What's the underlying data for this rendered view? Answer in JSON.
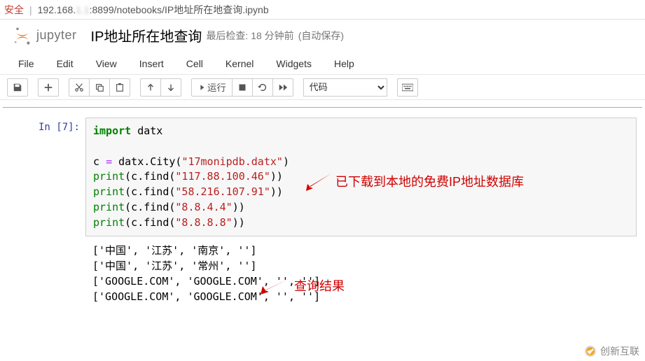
{
  "address_bar": {
    "security": "安全",
    "url_prefix": "192.168.",
    "url_blur": "1.1",
    "url_suffix": ":8899/notebooks/IP地址所在地查询.ipynb"
  },
  "header": {
    "logo_text": "jupyter",
    "notebook_title": "IP地址所在地查询",
    "last_check": "最后检查: 18 分钟前",
    "autosave": "(自动保存)"
  },
  "menu": {
    "items": [
      "File",
      "Edit",
      "View",
      "Insert",
      "Cell",
      "Kernel",
      "Widgets",
      "Help"
    ]
  },
  "toolbar": {
    "run_label": "运行",
    "cell_type": "代码"
  },
  "cell": {
    "prompt": "In  [7]:",
    "code": {
      "import_kw": "import",
      "import_mod": " datx",
      "assign_lhs": "c ",
      "assign_op": "=",
      "assign_rhs_a": " datx.City(",
      "db_file": "\"17monipdb.datx\"",
      "assign_rhs_b": ")",
      "p1a": "print",
      "p1b": "(c.find(",
      "p1s": "\"117.88.100.46\"",
      "p1c": "))",
      "p2a": "print",
      "p2b": "(c.find(",
      "p2s": "\"58.216.107.91\"",
      "p2c": "))",
      "p3a": "print",
      "p3b": "(c.find(",
      "p3s": "\"8.8.4.4\"",
      "p3c": "))",
      "p4a": "print",
      "p4b": "(c.find(",
      "p4s": "\"8.8.8.8\"",
      "p4c": "))"
    },
    "output": "['中国', '江苏', '南京', '']\n['中国', '江苏', '常州', '']\n['GOOGLE.COM', 'GOOGLE.COM', '', '']\n['GOOGLE.COM', 'GOOGLE.COM', '', '']"
  },
  "annotations": {
    "a1": "已下载到本地的免费IP地址数据库",
    "a2": "查询结果"
  },
  "watermark": "创新互联"
}
